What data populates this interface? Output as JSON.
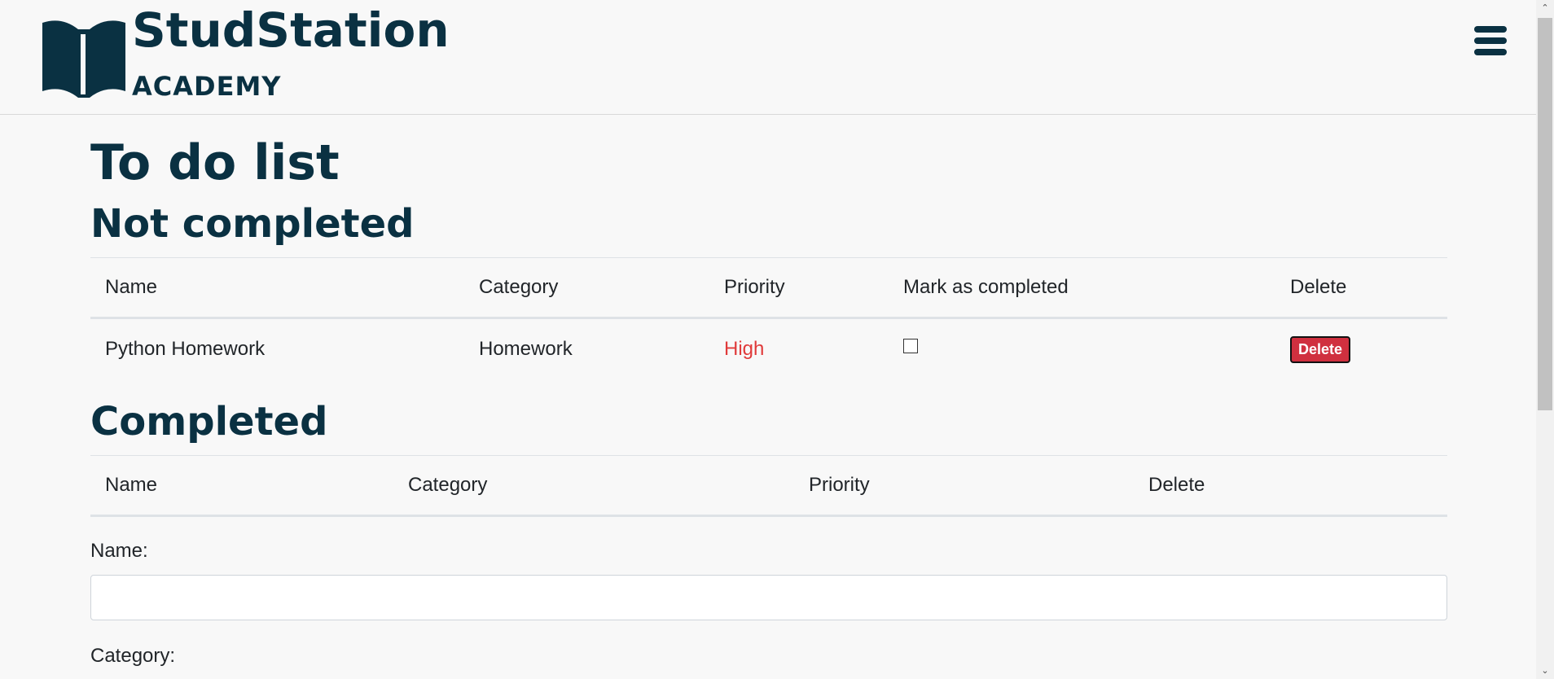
{
  "header": {
    "brand_name": "StudStation",
    "brand_sub": "ACADEMY",
    "logo_icon": "open-book-icon",
    "menu_icon": "hamburger-menu-icon"
  },
  "page": {
    "title": "To do list"
  },
  "not_completed": {
    "heading": "Not completed",
    "columns": [
      "Name",
      "Category",
      "Priority",
      "Mark as completed",
      "Delete"
    ],
    "rows": [
      {
        "name": "Python Homework",
        "category": "Homework",
        "priority": "High",
        "completed": false,
        "delete_label": "Delete"
      }
    ]
  },
  "completed": {
    "heading": "Completed",
    "columns": [
      "Name",
      "Category",
      "Priority",
      "Delete"
    ],
    "rows": []
  },
  "form": {
    "name_label": "Name:",
    "name_value": "",
    "category_label": "Category:"
  },
  "colors": {
    "brand": "#0a3142",
    "priority_high": "#e03a3a",
    "delete_button": "#d0303f"
  }
}
